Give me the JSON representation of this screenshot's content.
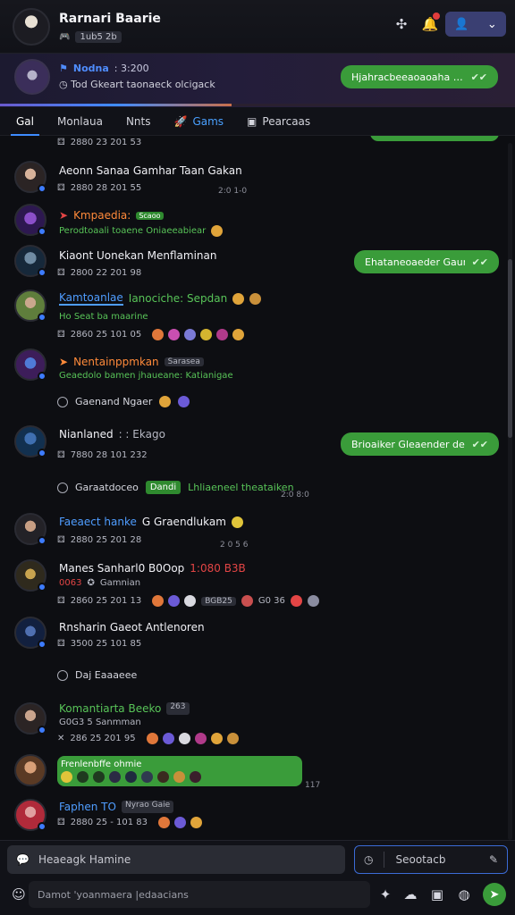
{
  "header": {
    "name": "Rarnari Baarie",
    "sub_tag": "1ub5 2b",
    "friends_icon": "user-icon",
    "chevron_icon": "chevron-down-icon"
  },
  "banner": {
    "title_highlight": "Nodna",
    "title_rest": ": 3:200",
    "subtitle": "Tod Gkeart taonaeck olcigack",
    "bubble": "Hjahracbeeaoaoaha banoan...",
    "progress_percent": 45
  },
  "tabs": [
    "Gal",
    "Monlaua",
    "Nnts",
    "Gams",
    "Pearcaas"
  ],
  "bubbles": {
    "b1": "Ehataneoaeder Gaunaero ...",
    "b2": "Brioaiker Gleaender deabl(P...",
    "b3": "Frenlenbffe ohmie"
  },
  "feed": {
    "r0_time": "2880 23 201 53",
    "r1_name": "Aeonn Sanaa Gamhar Taan Gakan",
    "r1_time": "2880 28 201 55",
    "r1_right": "2:0 1-0",
    "r2_name": "Kmpaedia:",
    "r2_tag": "Scaoo",
    "r2_sub": "Perodtoaali toaene Oniaeeabiear",
    "r3_name": "Kiaont Uonekan Menflaminan",
    "r3_time": "2800 22 201 98",
    "r4_name": "Kamtoanlae",
    "r4_name2": "Ianociche: Sepdan",
    "r4_sub": "Ho Seat ba maarine",
    "r4_time": "2860 25 101 05",
    "r5_name": "Nentainppmkan",
    "r5_tag": "Sarasea",
    "r5_sub": "Geaedolo bamen jhaueane: Katianigae",
    "r6_system": "Gaenand Ngaer",
    "r7_name": "Nianlaned",
    "r7_name_rest": ": : Ekago",
    "r7_time": "7880 28 101 232",
    "r8_system": "Garaatdoceo",
    "r8_badge": "Dandi",
    "r8_rest": "Lhliaeneel theataiken",
    "r8_right": "2:0 8:0",
    "r9_name": "Faeaect hanke",
    "r9_name2": "G Graendlukam",
    "r9_time": "2880 25 201 28",
    "r9_right": "2 0 5 6",
    "r10_name": "Manes Sanharl0 B0Oop",
    "r10_red": "1:080 B3B",
    "r10_sub": "Gamnian",
    "r10_subred": "0063",
    "r10_time": "2860 25 201 13",
    "r10_tail": "BGB25",
    "r10_tail2": "G0 36",
    "r11_name": "Rnsharin Gaeot Antlenoren",
    "r11_time": "3500 25 101 85",
    "r12_system": "Daj Eaaaeee",
    "r13_name": "Komantiarta Beeko",
    "r13_tag": "263",
    "r13_sub": "G0G3 5 Sanmman",
    "r13_time": "286 25 201 95",
    "r14_right": "117",
    "r15_name": "Faphen TO",
    "r15_tag": "Nyrao Gaie",
    "r15_time": "2880 25 - 101 83"
  },
  "composer": {
    "message_label": "Heaeagk Hamine",
    "search_label": "Seootacb",
    "bottom_placeholder": "Damot 'yoanmaera |edaacians"
  },
  "colors": {
    "accent": "#3e8cff",
    "bubble": "#3a9c3a",
    "friends_button": "#3a3f72",
    "background": "#0d0e12"
  }
}
